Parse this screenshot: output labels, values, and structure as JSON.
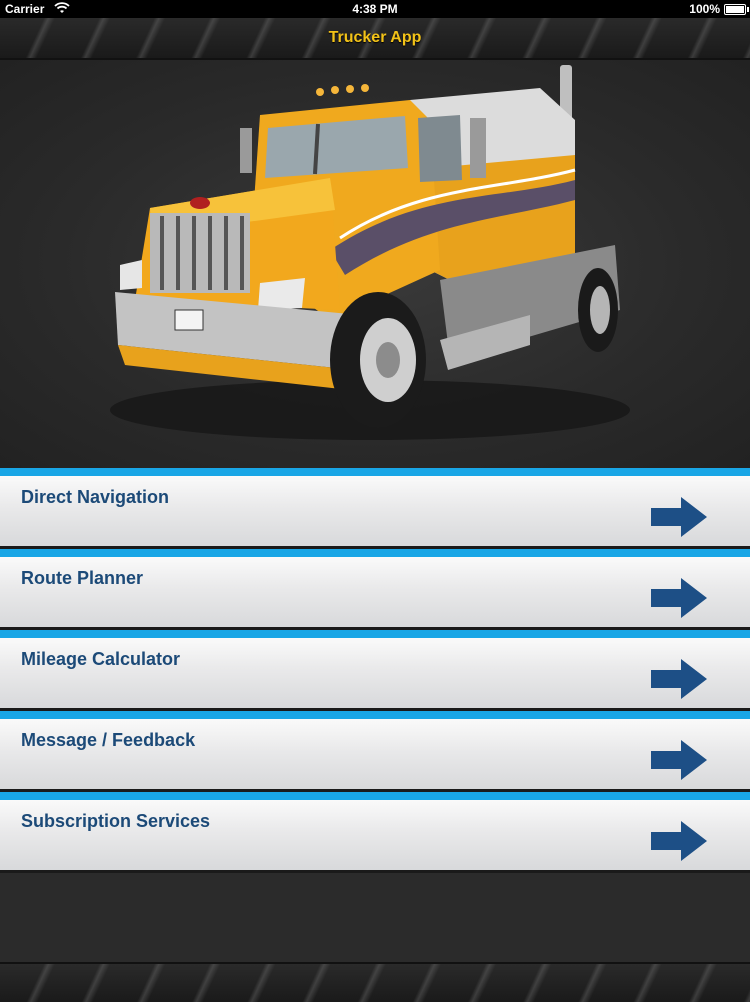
{
  "status_bar": {
    "carrier": "Carrier",
    "time": "4:38 PM",
    "battery": "100%"
  },
  "nav": {
    "title": "Trucker App"
  },
  "hero": {
    "image": "semi-truck-image"
  },
  "menu": {
    "items": [
      {
        "label": "Direct Navigation",
        "icon": "arrow-right-icon"
      },
      {
        "label": "Route Planner",
        "icon": "arrow-right-icon"
      },
      {
        "label": "Mileage Calculator",
        "icon": "arrow-right-icon"
      },
      {
        "label": "Message / Feedback",
        "icon": "arrow-right-icon"
      },
      {
        "label": "Subscription Services",
        "icon": "arrow-right-icon"
      }
    ]
  },
  "colors": {
    "title": "#f3c318",
    "accent": "#19a6e6",
    "label": "#1c4a78",
    "arrow": "#1d4f86"
  }
}
